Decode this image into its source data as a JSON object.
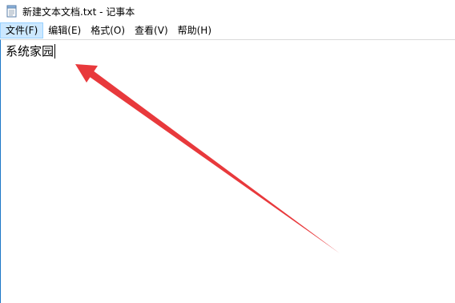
{
  "window": {
    "title": "新建文本文档.txt - 记事本"
  },
  "menu": {
    "items": [
      {
        "label": "文件(F)"
      },
      {
        "label": "编辑(E)"
      },
      {
        "label": "格式(O)"
      },
      {
        "label": "查看(V)"
      },
      {
        "label": "帮助(H)"
      }
    ]
  },
  "editor": {
    "content": "系统家园"
  },
  "colors": {
    "arrow": "#e8393c",
    "menu_active_bg": "#cce8ff",
    "menu_active_border": "#99d1ff",
    "editor_left_border": "#1e78c8"
  },
  "icons": {
    "app": "notepad-icon"
  }
}
